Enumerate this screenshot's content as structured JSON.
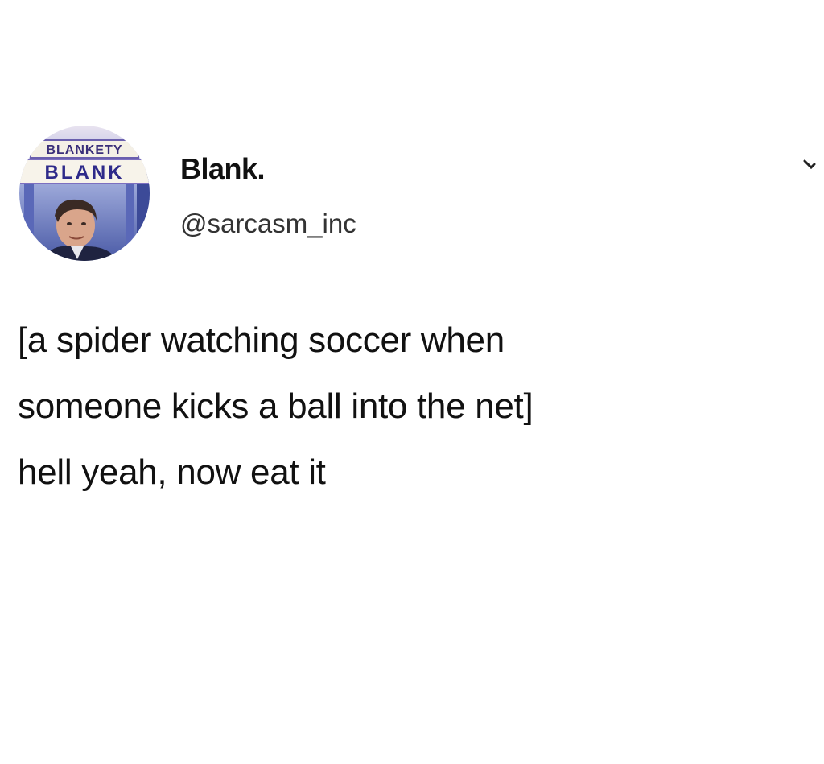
{
  "tweet": {
    "author": {
      "display_name": "Blank.",
      "handle": "@sarcasm_inc",
      "avatar_icon": "profile-picture",
      "avatar_sign_text": [
        "BLANKETY",
        "BLANK"
      ]
    },
    "menu_icon": "chevron-down-icon",
    "text_lines": [
      "[a spider watching soccer when",
      "someone kicks a ball into the net]",
      "hell yeah, now eat it"
    ]
  }
}
